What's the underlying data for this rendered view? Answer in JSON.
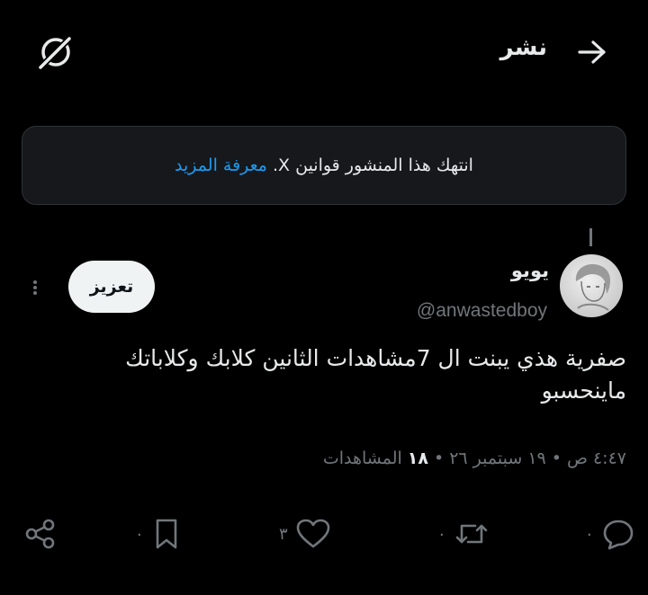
{
  "header": {
    "title": "نشر",
    "back_icon": "arrow-right-icon",
    "grok_icon": "grok-icon"
  },
  "notice": {
    "text": "انتهك هذا المنشور قوانين X.",
    "link": "معرفة المزيد",
    "link_color": "#1d9bf0"
  },
  "post": {
    "display_name": "يويو",
    "handle": "@anwastedboy",
    "boost_label": "تعزيز",
    "text": "صفرية هذي يبنت ال 7مشاهدات الثانين كلابك وكلاباتك ماينحسبو",
    "time": "٤:٤٧ ص",
    "date": "١٩ سبتمبر ٢٦",
    "views_count": "١٨",
    "views_label": "المشاهدات",
    "separator": "•"
  },
  "actions": {
    "replies": "٠",
    "reposts": "٠",
    "likes": "٣",
    "bookmarks": "٠"
  },
  "colors": {
    "background": "#000000",
    "text": "#e7e9ea",
    "muted": "#71767b",
    "notice_bg": "#16181c"
  }
}
